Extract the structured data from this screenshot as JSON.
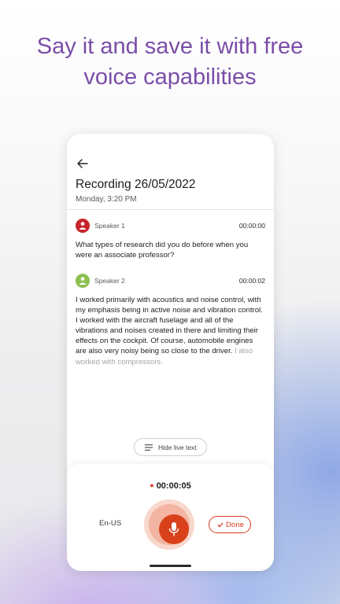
{
  "headline": {
    "line1": "Say it and save it with free",
    "line2": "voice capabilities"
  },
  "recording": {
    "title": "Recording 26/05/2022",
    "subtitle": "Monday, 3:20 PM"
  },
  "speakers": [
    {
      "name": "Speaker 1",
      "time": "00:00:00",
      "avatar_color": "#c8242b",
      "text": "What types of research did you do before when you were an associate professor?"
    },
    {
      "name": "Speaker 2",
      "time": "00:00:02",
      "avatar_color": "#8cc152",
      "text": "I worked primarily with acoustics and noise control, with my emphasis being in active noise and vibration control. I worked with the aircraft fuselage and all of the vibrations and noises created in there and limiting their effects on the cockpit. Of course, automobile engines are also very noisy being so close to the driver.",
      "text_faded": " I also worked with compressors."
    }
  ],
  "controls": {
    "hide_live_text": "Hide live text",
    "timer": "00:00:05",
    "language": "En-US",
    "done": "Done"
  },
  "colors": {
    "headline": "#7a4ea8",
    "accent": "#d9411a"
  }
}
